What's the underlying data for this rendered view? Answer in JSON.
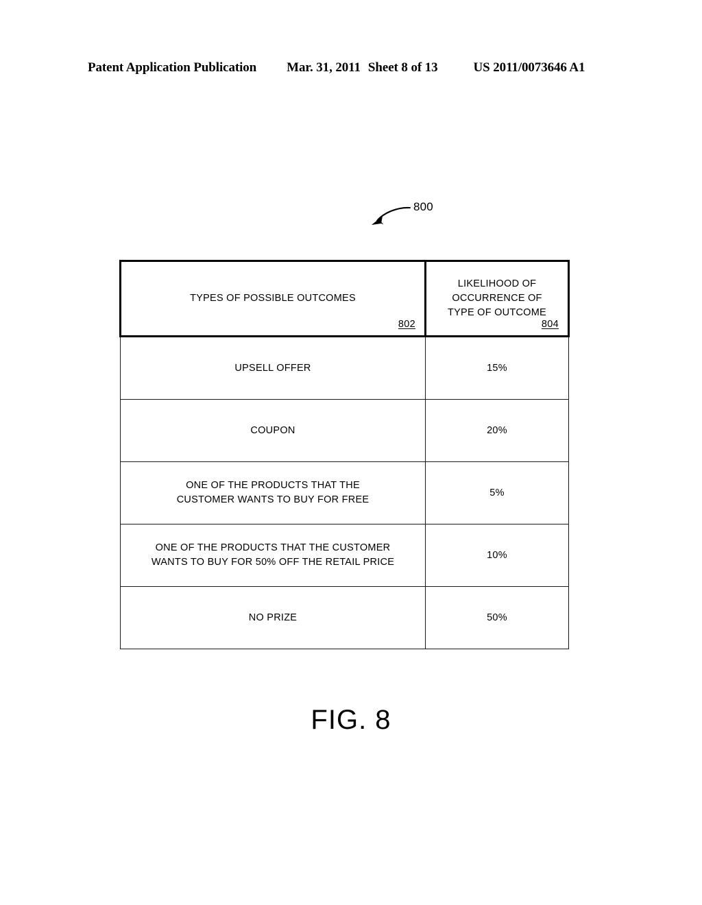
{
  "header": {
    "publication": "Patent Application Publication",
    "date": "Mar. 31, 2011",
    "sheet": "Sheet 8 of 13",
    "document_number": "US 2011/0073646 A1"
  },
  "figure": {
    "callout_label": "800",
    "caption": "FIG. 8"
  },
  "table": {
    "columns": [
      {
        "label": "TYPES OF POSSIBLE OUTCOMES",
        "ref": "802"
      },
      {
        "label": "LIKELIHOOD OF\nOCCURRENCE OF\nTYPE OF OUTCOME",
        "ref": "804"
      }
    ],
    "rows": [
      {
        "outcome": "UPSELL OFFER",
        "likelihood": "15%"
      },
      {
        "outcome": "COUPON",
        "likelihood": "20%"
      },
      {
        "outcome": "ONE OF THE PRODUCTS THAT THE\nCUSTOMER WANTS TO BUY FOR FREE",
        "likelihood": "5%"
      },
      {
        "outcome": "ONE OF THE PRODUCTS THAT THE CUSTOMER\nWANTS TO BUY FOR 50% OFF THE RETAIL PRICE",
        "likelihood": "10%"
      },
      {
        "outcome": "NO PRIZE",
        "likelihood": "50%"
      }
    ]
  },
  "colors": {
    "ink": "#000000",
    "rule": "#1a1a1a",
    "page": "#ffffff"
  }
}
